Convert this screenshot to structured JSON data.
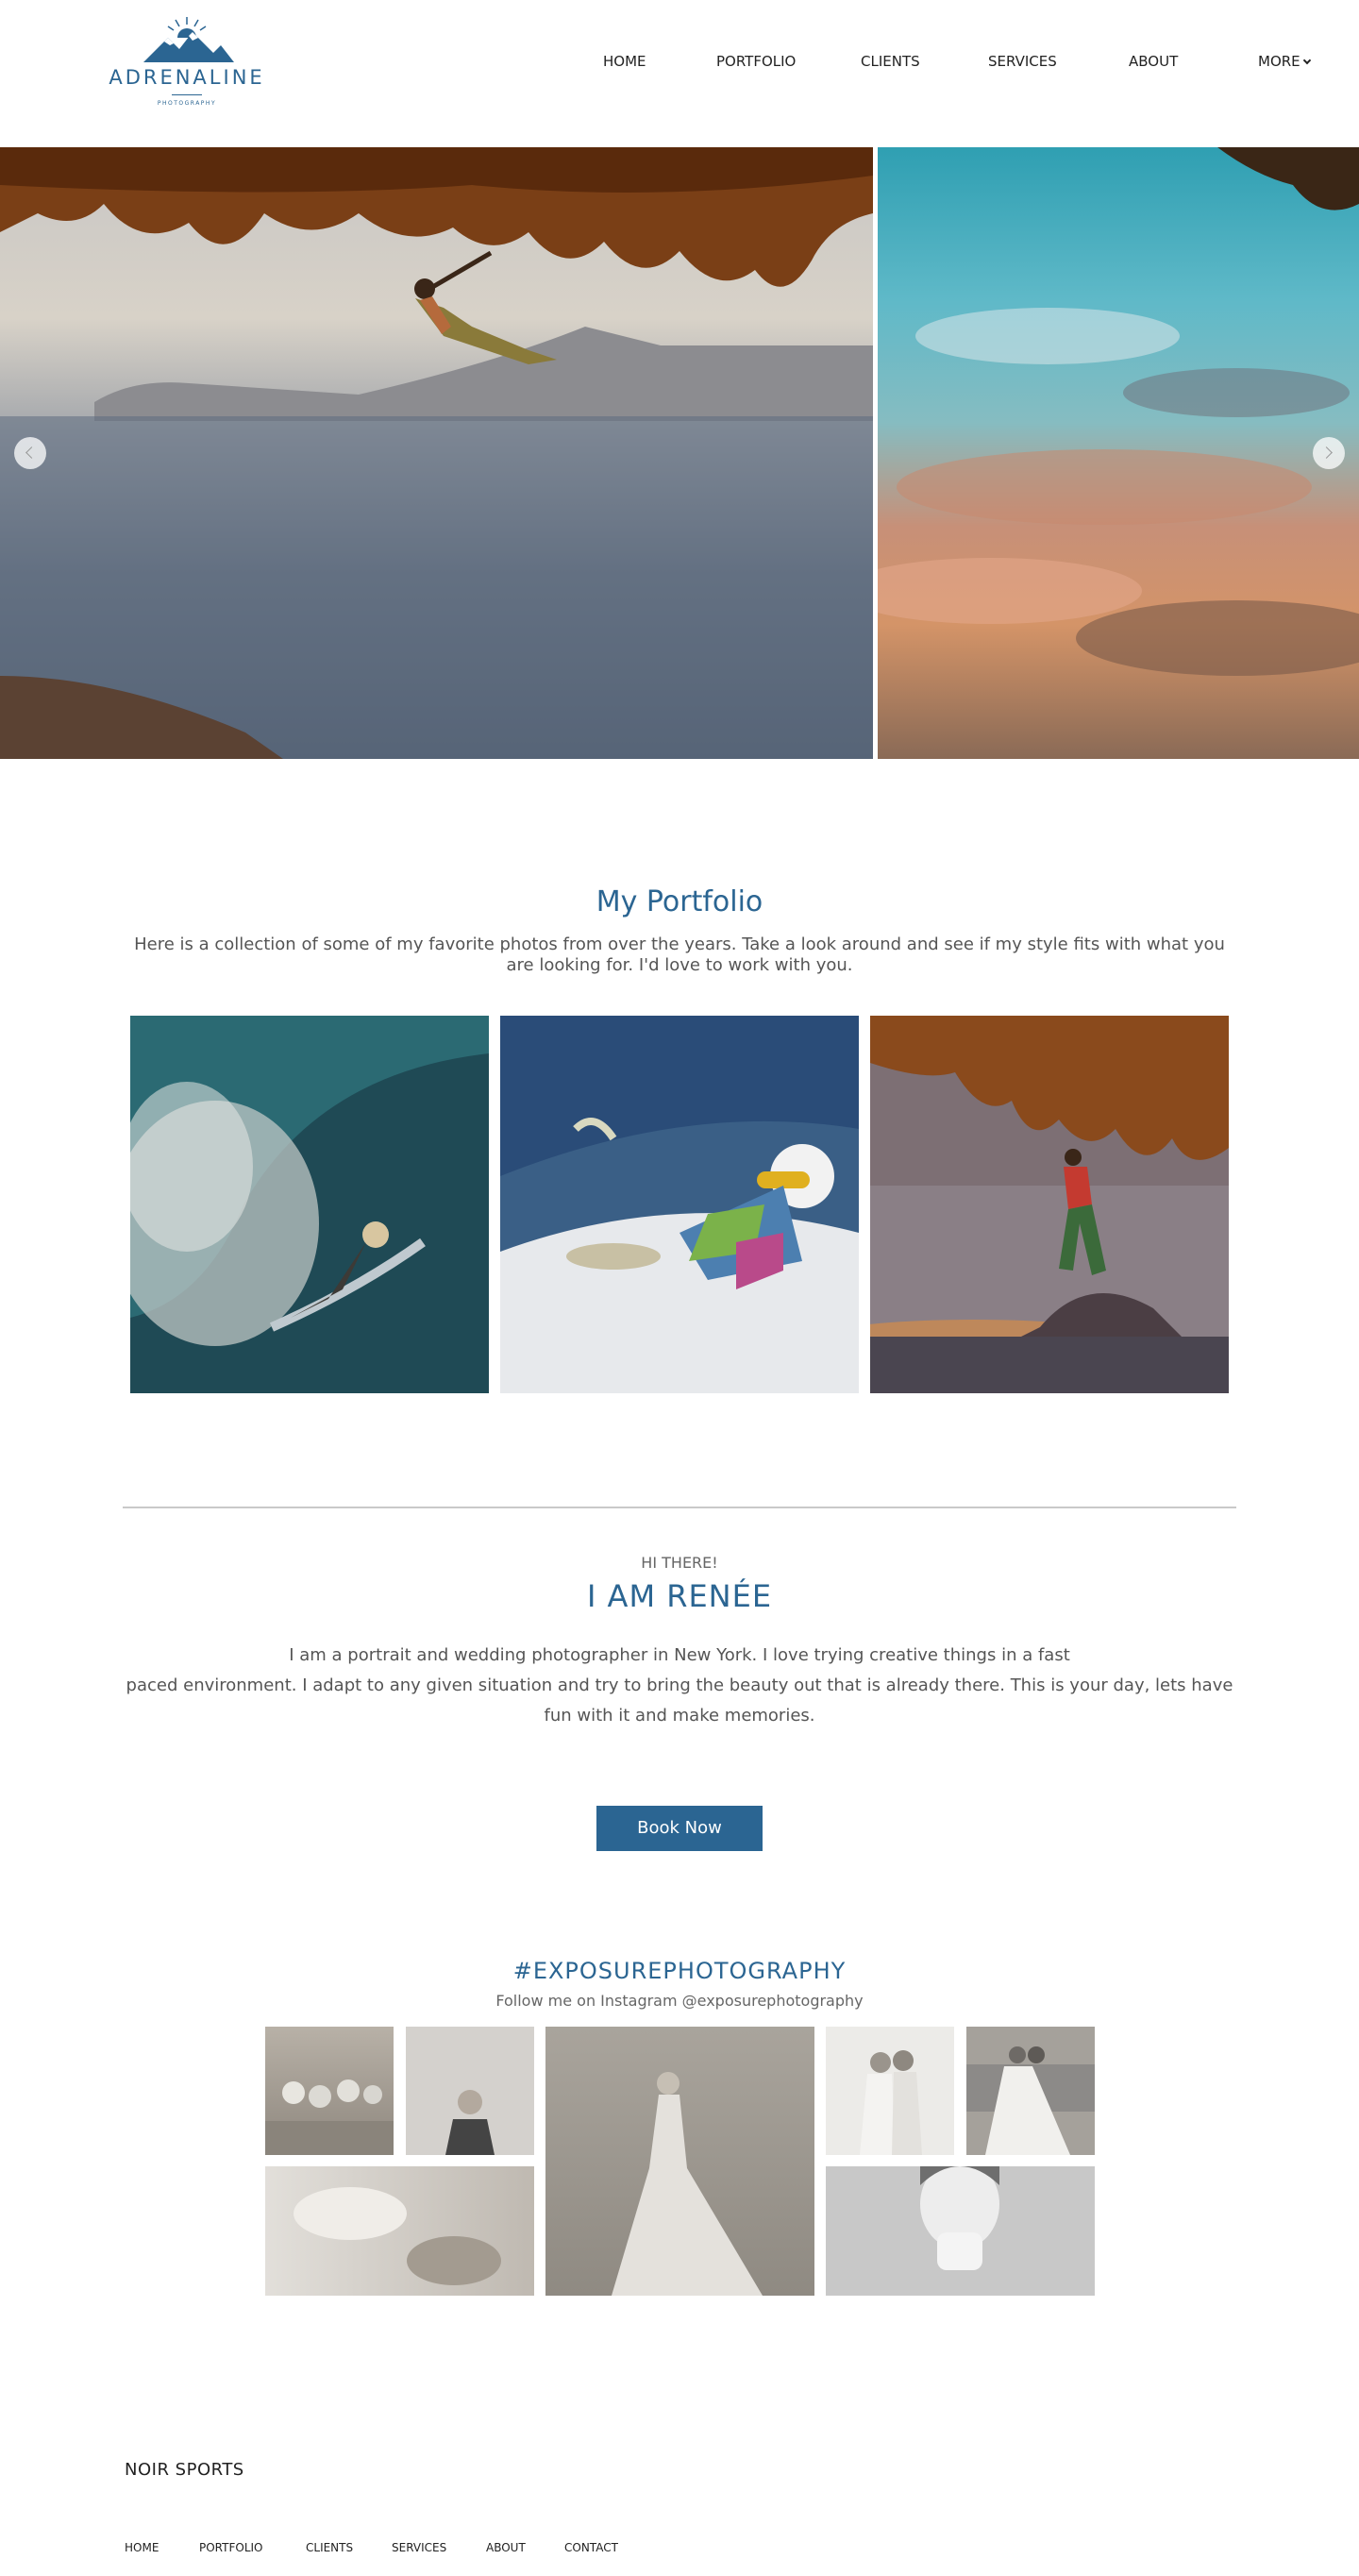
{
  "brand": {
    "logo_word": "ADRENALINE",
    "logo_sub": "PHOTOGRAPHY",
    "color": "#2b6592"
  },
  "nav": {
    "items": [
      "HOME",
      "PORTFOLIO",
      "CLIENTS",
      "SERVICES",
      "ABOUT",
      "MORE"
    ]
  },
  "hero": {
    "slides": [
      "cliff-climber-over-sea",
      "sunset-clouds-sky"
    ],
    "prev_icon": "chevron-left-icon",
    "next_icon": "chevron-right-icon"
  },
  "portfolio": {
    "title": "My Portfolio",
    "intro": "Here is a collection of some of my favorite photos from over the years. Take a look around and see if my style fits with what you are looking for. I'd love to work with you.",
    "tiles": [
      "surfer-underwater-wave",
      "kitesurfer-in-snow",
      "climber-under-overhang"
    ]
  },
  "about": {
    "greeting": "HI THERE!",
    "title": "I AM RENÉE",
    "line1": "I am a portrait and wedding photographer in New York. I love trying creative things in a fast",
    "line2": "paced environment. I adapt to any given situation and try to bring the beauty out that is already there. This is your day, lets have",
    "line3": "fun with it and make memories.",
    "button": "Book Now"
  },
  "instagram": {
    "title": "#EXPOSUREPHOTOGRAPHY",
    "subtitle": "Follow me on Instagram @exposurephotography"
  },
  "footer": {
    "brand": "NOIR SPORTS",
    "links": [
      "HOME",
      "PORTFOLIO",
      "CLIENTS",
      "SERVICES",
      "ABOUT",
      "CONTACT"
    ]
  }
}
